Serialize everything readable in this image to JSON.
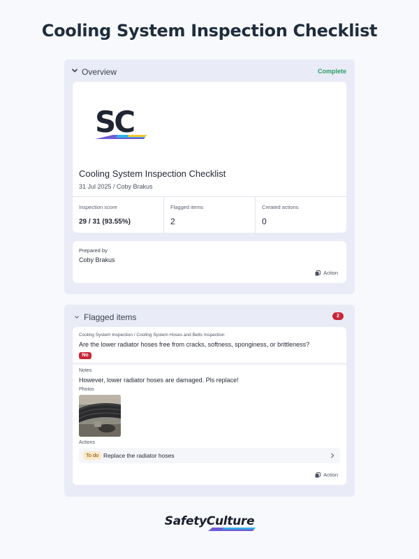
{
  "page_title": "Cooling System Inspection Checklist",
  "overview": {
    "title": "Overview",
    "status": "Complete",
    "logo_text": "SC",
    "doc_title": "Cooling System Inspection Checklist",
    "doc_subtitle": "31 Jul 2025 / Coby Brakus",
    "stats": [
      {
        "label": "Inspection score",
        "value": "29 / 31 (93.55%)"
      },
      {
        "label": "Flagged items",
        "value": "2"
      },
      {
        "label": "Created actions",
        "value": "0"
      }
    ],
    "prepared_label": "Prepared by",
    "prepared_name": "Coby Brakus",
    "action_label": "Action"
  },
  "flagged": {
    "title": "Flagged items",
    "count": "2",
    "question_path": "Cooling System Inspection / Cooling System Hoses and Belts Inspection",
    "question": "Are the lower radiator hoses free from cracks, softness, sponginess, or brittleness?",
    "answer": "No",
    "notes_label": "Notes",
    "notes": "However, lower radiator hoses are damaged. Pls replace!",
    "photos_label": "Photos",
    "actions_label": "Actions",
    "action_status": "To do",
    "action_text": "Replace the radiator hoses",
    "action_label": "Action"
  },
  "brand": {
    "name": "SafetyCulture"
  },
  "colors": {
    "flag_red": "#c8263a",
    "complete_green": "#2a9d6a",
    "todo_bg": "#fbe9c8",
    "panel_bg": "#e9ebf6"
  }
}
